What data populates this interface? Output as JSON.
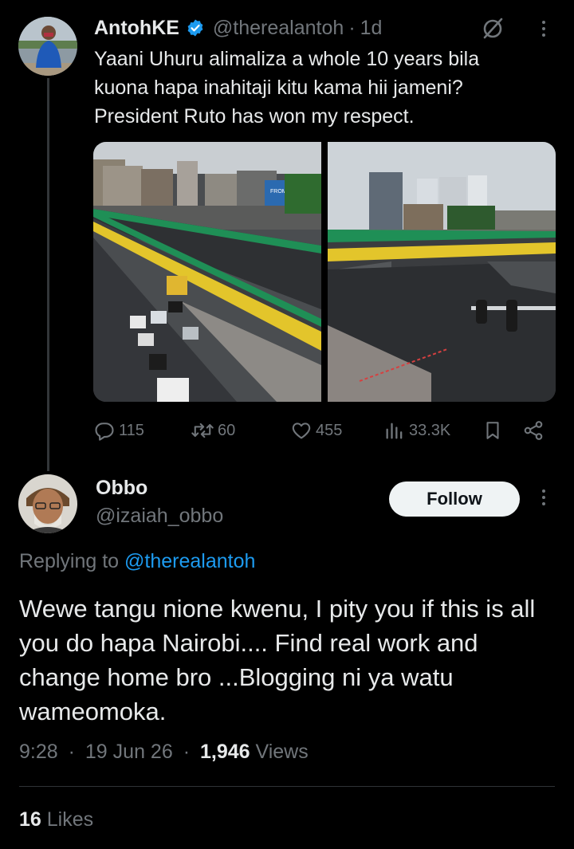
{
  "original_post": {
    "author_name": "AntohKE",
    "verified": true,
    "handle": "@therealantoh",
    "time_ago": "1d",
    "text": "Yaani Uhuru alimaliza a whole 10 years bila\nkuona hapa inahitaji kitu kama hii jameni?\nPresident Ruto has won my respect.",
    "images": [
      {
        "icon": "flyover-photo-left",
        "billboard_text": "FROM THE"
      },
      {
        "icon": "flyover-photo-right"
      }
    ],
    "actions": {
      "replies": "115",
      "reposts": "60",
      "likes": "455",
      "views": "33.3K"
    }
  },
  "reply": {
    "author_name": "Obbo",
    "handle": "@izaiah_obbo",
    "follow_label": "Follow",
    "replying_prefix": "Replying to",
    "replying_handle": "@therealantoh",
    "text": "Wewe tangu nione kwenu, I pity  you if this is all you do hapa Nairobi.... Find real work and change home bro ...Blogging ni ya watu wameomoka.",
    "time": "9:28",
    "date": "19 Jun 26",
    "views_count": "1,946",
    "views_label": "Views",
    "likes_count": "16",
    "likes_label": "Likes"
  },
  "colors": {
    "background": "#000000",
    "text_primary": "#e7e9ea",
    "text_secondary": "#71767b",
    "accent": "#1d9bf0",
    "verified_badge": "#1d9bf0",
    "follow_button_bg": "#eff3f4"
  }
}
